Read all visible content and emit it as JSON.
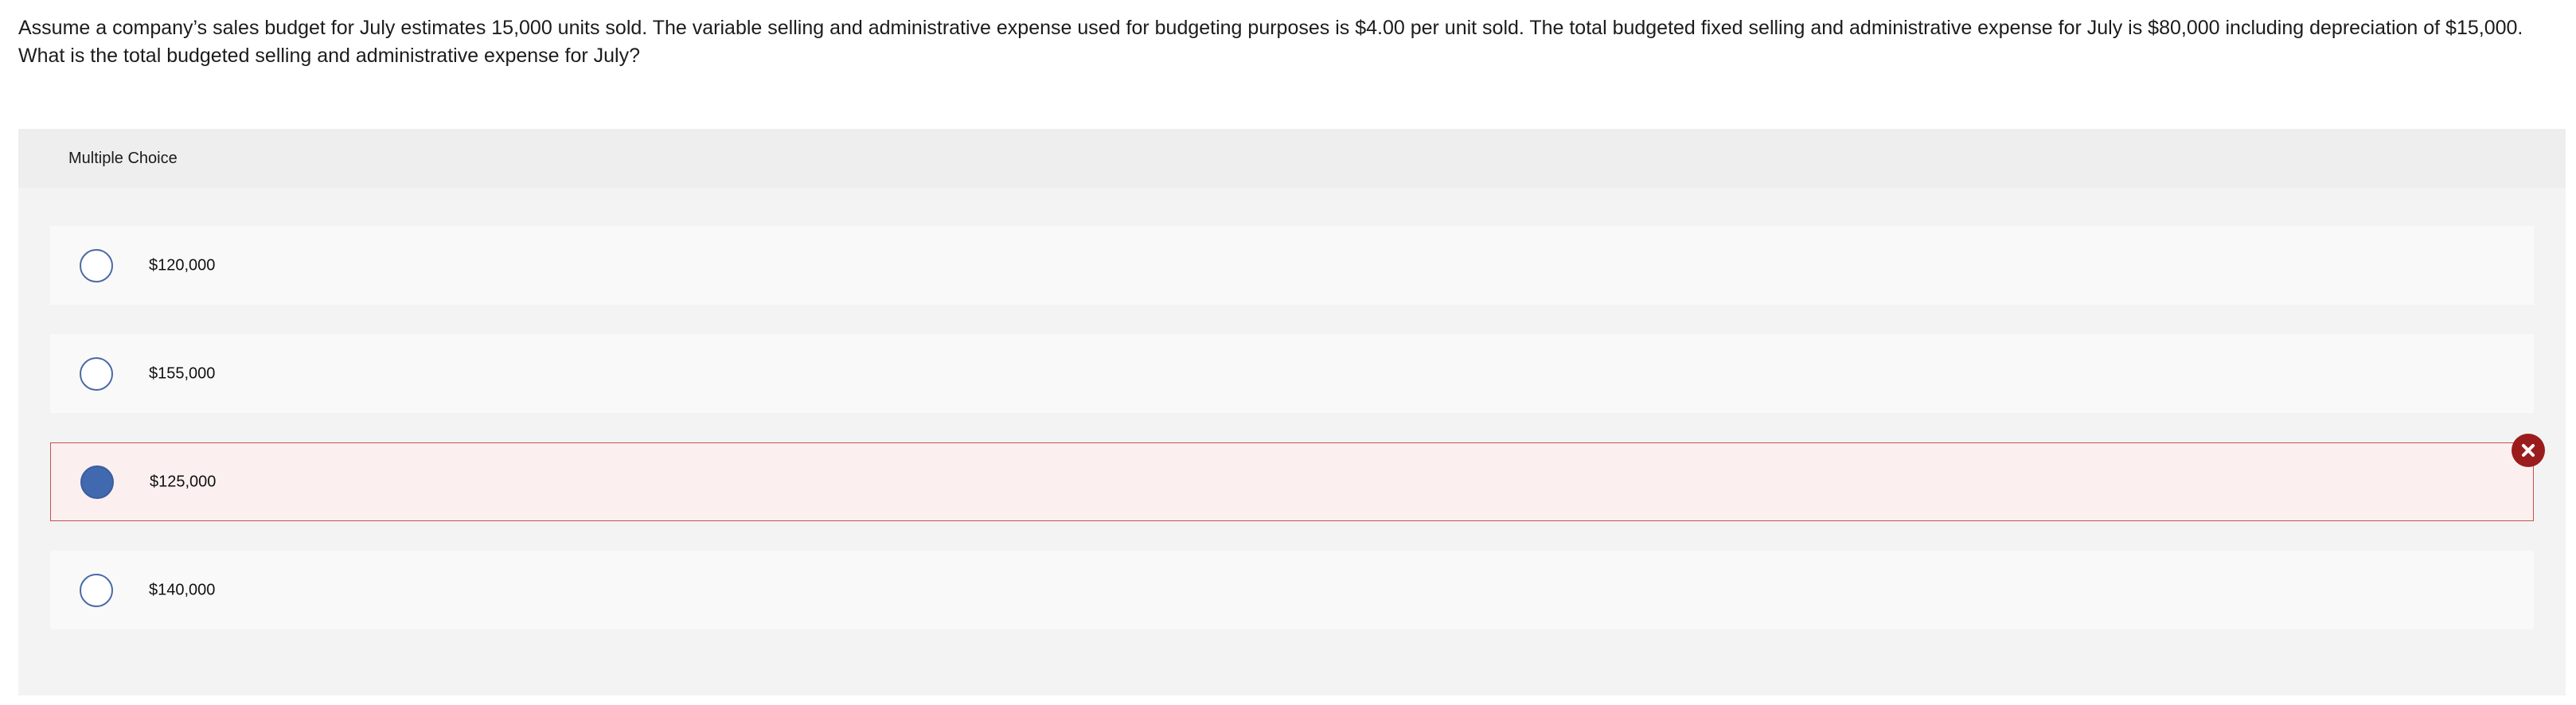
{
  "question": {
    "text": "Assume a company’s sales budget for July estimates 15,000 units sold. The variable selling and administrative expense used for budgeting purposes is $4.00 per unit sold. The total budgeted fixed selling and administrative expense for July is $80,000 including depreciation of $15,000. What is the total budgeted selling and administrative expense for July?"
  },
  "panel": {
    "header": "Multiple Choice"
  },
  "options": [
    {
      "label": "$120,000",
      "selected": false,
      "state": "default"
    },
    {
      "label": "$155,000",
      "selected": false,
      "state": "default"
    },
    {
      "label": "$125,000",
      "selected": true,
      "state": "incorrect"
    },
    {
      "label": "$140,000",
      "selected": false,
      "state": "default"
    }
  ],
  "icons": {
    "incorrect_badge": "x-circle-icon"
  },
  "colors": {
    "accent_radio": "#4169b0",
    "incorrect_border": "#c7514c",
    "incorrect_badge": "#9b1c1c",
    "incorrect_bg": "#fbf0ef"
  }
}
